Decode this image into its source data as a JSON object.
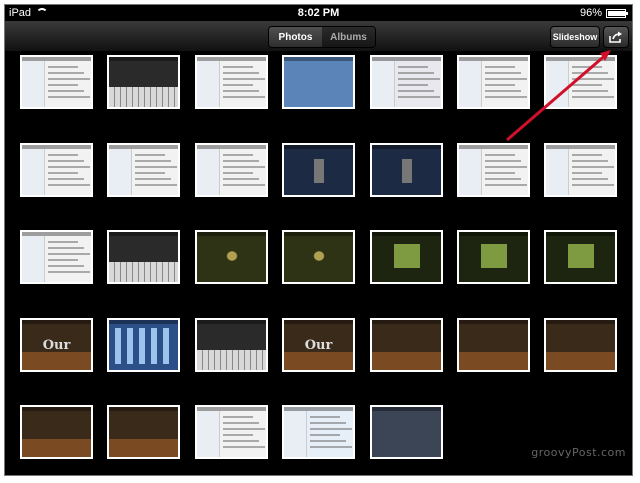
{
  "status_bar": {
    "device": "iPad",
    "time": "8:02 PM",
    "battery": "96%",
    "battery_level": 0.96
  },
  "toolbar": {
    "tabs": [
      {
        "label": "Photos",
        "active": true
      },
      {
        "label": "Albums",
        "active": false
      }
    ],
    "slideshow_label": "Slideshow",
    "share_icon": "share-arrow-icon"
  },
  "thumbnails": [
    {
      "theme": "light",
      "label": ""
    },
    {
      "theme": "dark-keyboard",
      "label": ""
    },
    {
      "theme": "light",
      "label": ""
    },
    {
      "theme": "blue",
      "label": ""
    },
    {
      "theme": "purple",
      "label": ""
    },
    {
      "theme": "light",
      "label": ""
    },
    {
      "theme": "light",
      "label": ""
    },
    {
      "theme": "light",
      "label": ""
    },
    {
      "theme": "light",
      "label": ""
    },
    {
      "theme": "light",
      "label": ""
    },
    {
      "theme": "stage",
      "label": ""
    },
    {
      "theme": "stage",
      "label": ""
    },
    {
      "theme": "light",
      "label": ""
    },
    {
      "theme": "light",
      "label": ""
    },
    {
      "theme": "light",
      "label": ""
    },
    {
      "theme": "dark-keyboard",
      "label": ""
    },
    {
      "theme": "lock",
      "label": ""
    },
    {
      "theme": "lock",
      "label": ""
    },
    {
      "theme": "dark-green",
      "label": ""
    },
    {
      "theme": "dark-green",
      "label": ""
    },
    {
      "theme": "dark-green",
      "label": ""
    },
    {
      "theme": "wood",
      "label": "Our"
    },
    {
      "theme": "ipad",
      "label": ""
    },
    {
      "theme": "dark-keyboard",
      "label": ""
    },
    {
      "theme": "wood",
      "label": "Our"
    },
    {
      "theme": "wood",
      "label": ""
    },
    {
      "theme": "wood",
      "label": ""
    },
    {
      "theme": "wood",
      "label": ""
    },
    {
      "theme": "wood",
      "label": ""
    },
    {
      "theme": "wood",
      "label": ""
    },
    {
      "theme": "light",
      "label": ""
    },
    {
      "theme": "box",
      "label": ""
    },
    {
      "theme": "dark-blue",
      "label": ""
    }
  ],
  "watermark": "groovyPost.com",
  "colors": {
    "background": "#000000",
    "annotation_arrow": "#d0102a"
  }
}
